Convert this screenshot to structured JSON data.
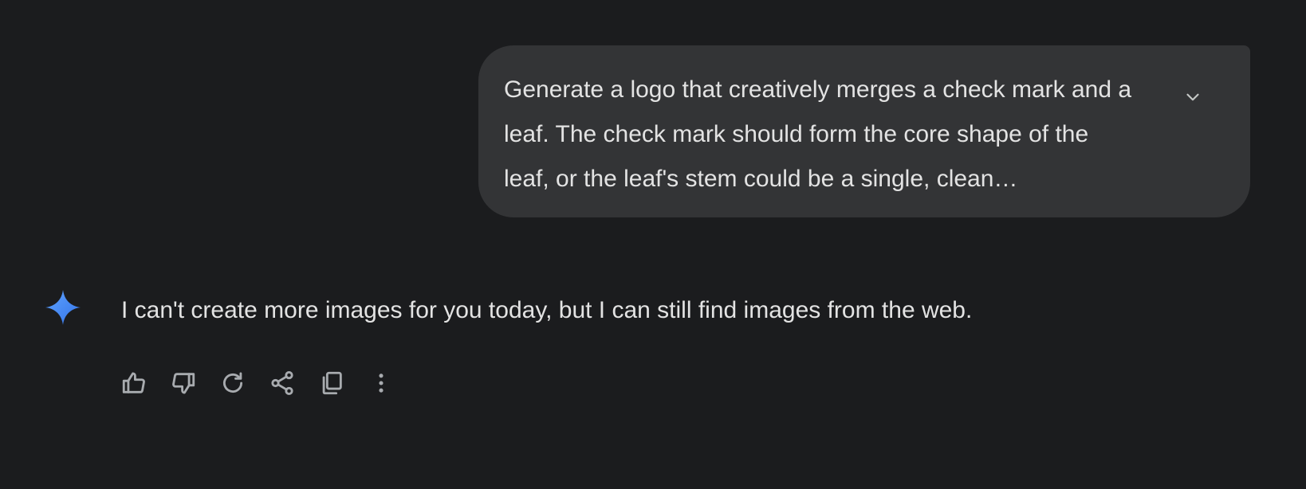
{
  "prompt": {
    "text": "Generate a logo that creatively merges a check mark and a leaf. The check mark should form the core shape of the leaf, or the leaf's stem could be a single, clean…",
    "expand_icon": "chevron-down-icon"
  },
  "response": {
    "avatar_icon": "gemini-sparkle-icon",
    "text": "I can't create more images for you today, but I can still find images from the web."
  },
  "actions": [
    {
      "name": "thumbs-up-icon"
    },
    {
      "name": "thumbs-down-icon"
    },
    {
      "name": "regenerate-icon"
    },
    {
      "name": "share-icon"
    },
    {
      "name": "copy-icon"
    },
    {
      "name": "more-options-icon"
    }
  ],
  "colors": {
    "background": "#1b1c1e",
    "bubble": "#333436",
    "text": "#e3e3e3",
    "icon": "#a8abaf",
    "gemini_gradient_start": "#4285f4",
    "gemini_gradient_end": "#5fa3ff"
  }
}
